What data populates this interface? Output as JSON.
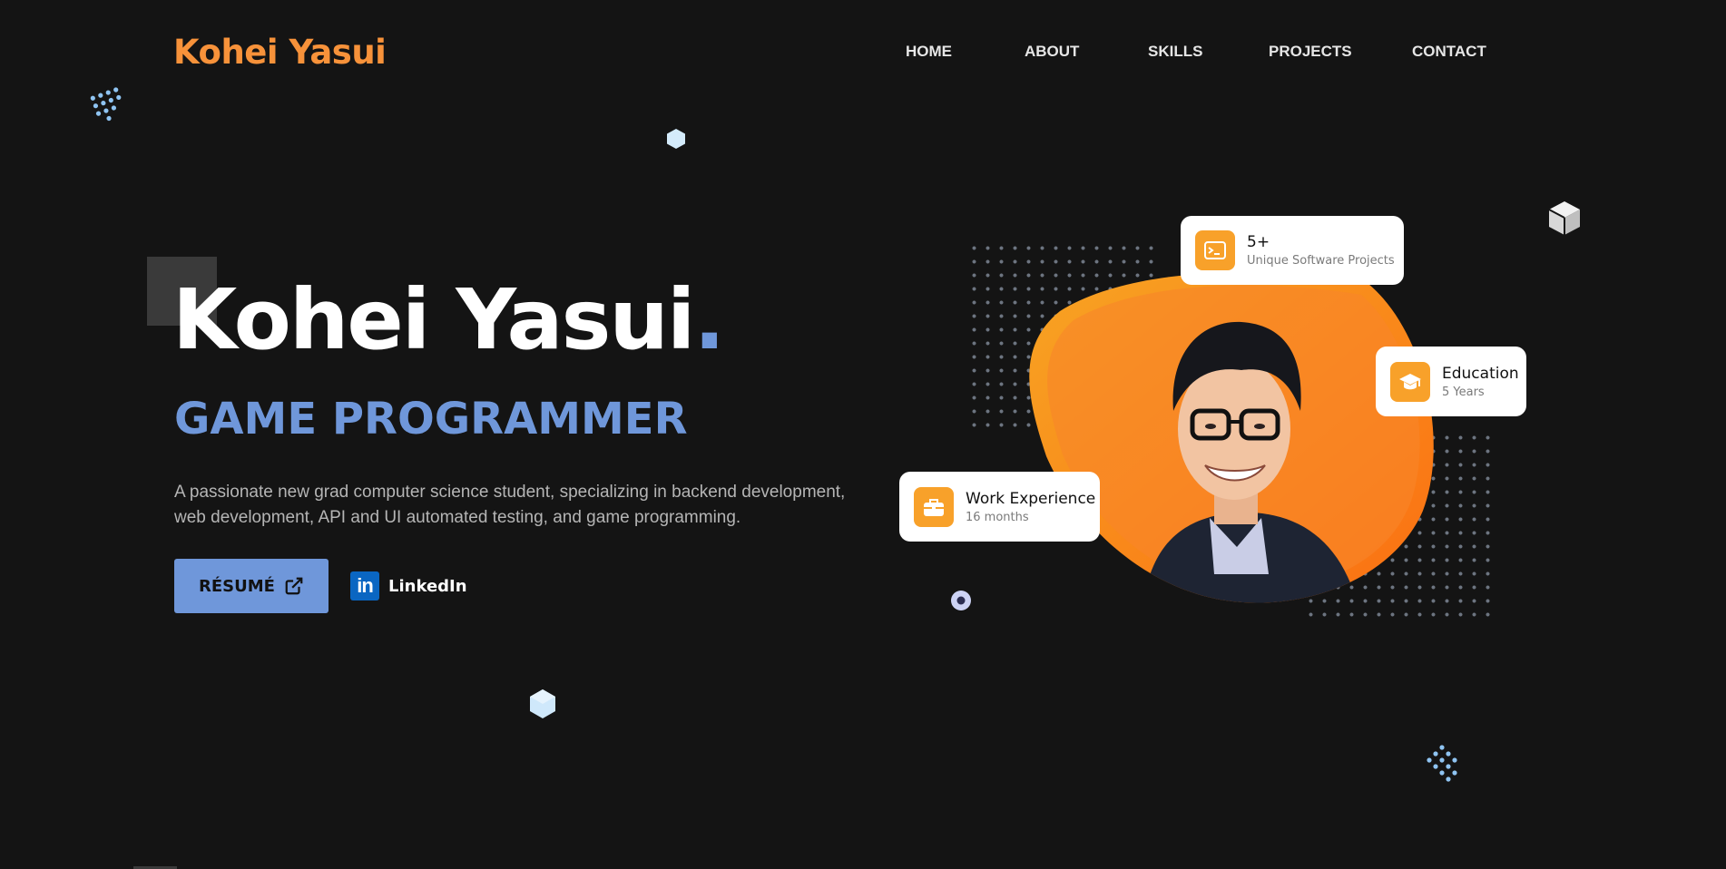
{
  "header": {
    "logo": "Kohei Yasui",
    "nav": [
      "HOME",
      "ABOUT",
      "SKILLS",
      "PROJECTS",
      "CONTACT"
    ]
  },
  "hero": {
    "name": "Kohei Yasui",
    "dot": ".",
    "role": "GAME PROGRAMMER",
    "description": "A passionate new grad computer science student, specializing in backend development, web development, API and UI automated testing, and game programming.",
    "resume_label": "RÉSUMÉ",
    "linkedin_label": "LinkedIn",
    "linkedin_logo": "in"
  },
  "stats": {
    "projects": {
      "value": "5+",
      "label": "Unique Software Projects",
      "icon": "terminal-icon"
    },
    "education": {
      "value": "Education",
      "label": "5 Years",
      "icon": "graduation-cap-icon"
    },
    "work": {
      "value": "Work Experience",
      "label": "16 months",
      "icon": "briefcase-icon"
    }
  },
  "colors": {
    "background": "#141414",
    "logo": "#f7923a",
    "accent_blue": "#6f97da",
    "accent_orange": "#f8a12a",
    "blob_orange": "#fb7d1c"
  }
}
